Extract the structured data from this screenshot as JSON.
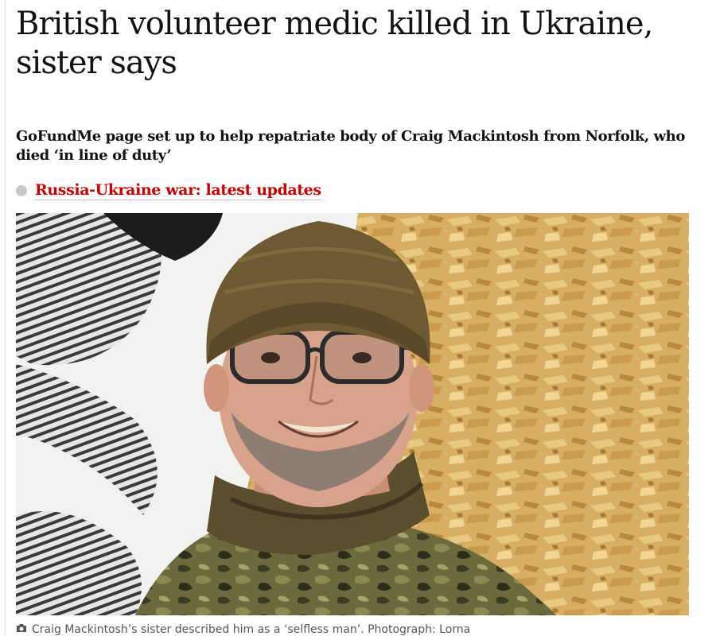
{
  "article": {
    "headline": "British volunteer medic killed in Ukraine, sister says",
    "standfirst": "GoFundMe page set up to help repatriate body of Craig Mackintosh from Norfolk, who died ‘in line of duty’",
    "live_link": "Russia-Ukraine war: latest updates",
    "caption": "Craig Mackintosh’s sister described him as a ‘selfless man’. Photograph: Lorna"
  },
  "colors": {
    "link_red": "#c70000",
    "text": "#121212",
    "dot_grey": "#c8c8c8"
  },
  "icons": {
    "live_indicator": "live-dot-icon",
    "caption": "camera-icon"
  }
}
